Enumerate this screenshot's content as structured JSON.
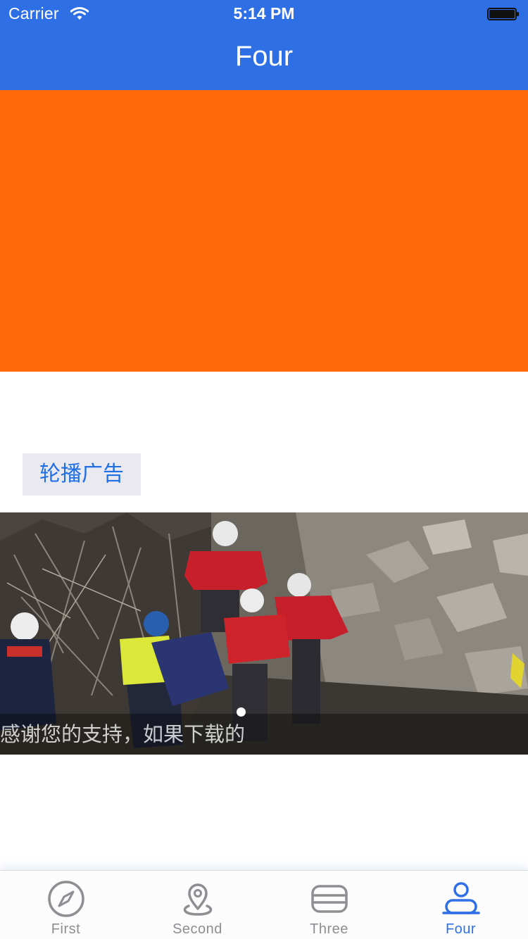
{
  "status_bar": {
    "carrier": "Carrier",
    "time": "5:14 PM",
    "icons": [
      "wifi-icon",
      "battery-icon"
    ]
  },
  "nav": {
    "title": "Four"
  },
  "colors": {
    "nav": "#2f6fe5",
    "orange_panel": "#ff6a08",
    "accent": "#2f6fe5",
    "inactive": "#8e8e93",
    "ad_button_bg": "#e9e9ef"
  },
  "ad_button": {
    "label": "轮播广告"
  },
  "banner": {
    "caption": "感谢您的支持，如果下载的",
    "page_indicator": {
      "current": 1,
      "total": 1
    }
  },
  "tabs": [
    {
      "label": "First",
      "icon": "compass-icon",
      "active": false
    },
    {
      "label": "Second",
      "icon": "location-pin-icon",
      "active": false
    },
    {
      "label": "Three",
      "icon": "card-icon",
      "active": false
    },
    {
      "label": "Four",
      "icon": "user-icon",
      "active": true
    }
  ]
}
